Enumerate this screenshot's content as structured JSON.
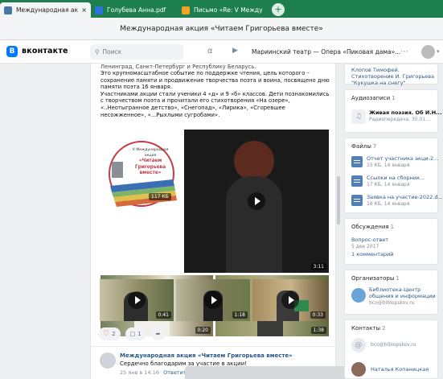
{
  "browser": {
    "tabs": [
      {
        "label": "Международная акци",
        "close": "×",
        "active": true,
        "icon_color": "#4a76a8"
      },
      {
        "label": "Голубева Анна.pdf",
        "active": false,
        "icon_color": "#2f6fe0"
      },
      {
        "label": "Письмо «Re: V Междунар",
        "active": false,
        "icon_color": "#f2a324"
      }
    ],
    "new_tab": "+",
    "window_title": "Международная акция «Читаем Григорьева вместе»"
  },
  "vk": {
    "logo_letter": "vk",
    "brand": "вконтакте",
    "search_placeholder": "Поиск",
    "now_playing": "Мариинский театр — Опера «Пиковая дама»..."
  },
  "post": {
    "text_top": "Ленинград, Санкт-Петербург и Республику Беларусь.",
    "para1": "Это крупномасштабное событие по поддержке чтения, цель которого – сохранение памяти и продвижение творчества поэта и воина, посвящено дню памяти поэта 16 января.",
    "para2": "Участниками акции стали ученики 4 «д» и 9 «б» классов. Дети познакомились с творчеством поэта и прочитали его стихотворения «На озере», «..Неотыгранное детство», «Снегопад», «Лирика», «Сгоревшее несожженное», «...Рыхлыми сугробами».",
    "poster": {
      "lines": [
        "V Международная",
        "акция",
        "«Читаем",
        "Григорьева",
        "вместе»"
      ],
      "size": "117 КБ"
    },
    "videos": [
      {
        "duration": "3:11"
      },
      {
        "duration": "0:20"
      },
      {
        "duration": "1:38"
      },
      {
        "duration": "0:41"
      },
      {
        "duration": "1:18"
      },
      {
        "duration": "0:33"
      }
    ],
    "reactions": {
      "likes": "2",
      "comments": "1"
    },
    "comment": {
      "author": "Международная акция «Читаем Григорьева вместе»",
      "text": "Сердечно благодарим за участие в акции!",
      "date": "25 янв в 14:16",
      "reply": "Ответить"
    }
  },
  "sidebar": {
    "top_link": "Клопов Тимофей. Стихотворение И. Григорьева \"Кукушка на снегу\"",
    "audio": {
      "title": "Аудиозаписи",
      "count": "1",
      "track": "Живая поэзия. Об И.Н...",
      "sub": "Радиопередача. 30.01..."
    },
    "files": {
      "title": "Файлы",
      "count": "7",
      "items": [
        {
          "name": "Отчет участника акци-2...",
          "meta": "15 КБ, 14 января"
        },
        {
          "name": "Ссылки на сборник...",
          "meta": "17 КБ, 14 января"
        },
        {
          "name": "Заявка на участие-2022.d...",
          "meta": "16 КБ, 14 января"
        }
      ]
    },
    "discussions": {
      "title": "Обсуждения",
      "count": "1",
      "topic": "Вопрос-ответ",
      "date": "5 дек 2017",
      "comments": "1 комментарий"
    },
    "organizers": {
      "title": "Организаторы",
      "count": "1",
      "name_line1": "Библиотека-Центр",
      "name_line2": "общения и информации",
      "email": "bco@biblopskov.ru"
    },
    "contacts": {
      "title": "Контакты",
      "count": "2",
      "email": "bco@biblopskov.ru",
      "person": "Наталья Копаницкая"
    }
  }
}
